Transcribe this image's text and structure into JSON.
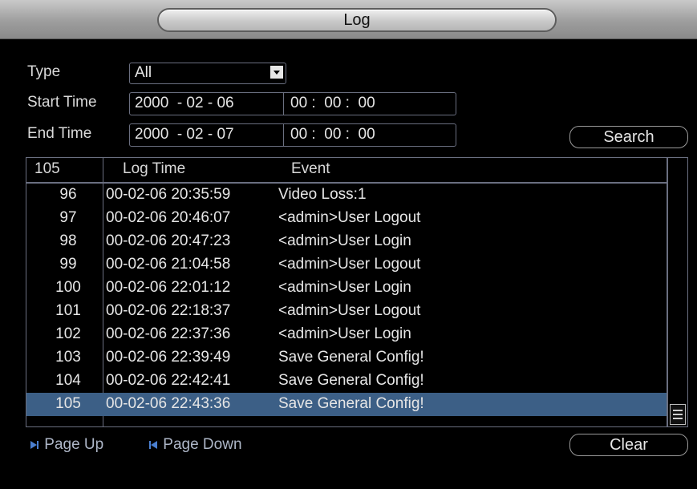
{
  "window": {
    "title": "Log"
  },
  "filters": {
    "type_label": "Type",
    "type_value": "All",
    "start_label": "Start Time",
    "start_date": "2000  - 02 - 06",
    "start_time": "00 :  00 :  00",
    "end_label": "End Time",
    "end_date": "2000  - 02 - 07",
    "end_time": "00 :  00 :  00",
    "search_label": "Search"
  },
  "table": {
    "header_count": "105",
    "col_time": "Log Time",
    "col_event": "Event",
    "rows": [
      {
        "no": "96",
        "time": "00-02-06 20:35:59",
        "event": "Video Loss:1"
      },
      {
        "no": "97",
        "time": "00-02-06 20:46:07",
        "event": "<admin>User Logout"
      },
      {
        "no": "98",
        "time": "00-02-06 20:47:23",
        "event": "<admin>User Login"
      },
      {
        "no": "99",
        "time": "00-02-06 21:04:58",
        "event": "<admin>User Logout"
      },
      {
        "no": "100",
        "time": "00-02-06 22:01:12",
        "event": "<admin>User Login"
      },
      {
        "no": "101",
        "time": "00-02-06 22:18:37",
        "event": "<admin>User Logout"
      },
      {
        "no": "102",
        "time": "00-02-06 22:37:36",
        "event": "<admin>User Login"
      },
      {
        "no": "103",
        "time": "00-02-06 22:39:49",
        "event": "Save General Config!"
      },
      {
        "no": "104",
        "time": "00-02-06 22:42:41",
        "event": "Save General Config!"
      },
      {
        "no": "105",
        "time": "00-02-06 22:43:36",
        "event": "Save General Config!"
      }
    ],
    "selected_row": 9
  },
  "footer": {
    "page_up": "Page Up",
    "page_down": "Page Down",
    "clear_label": "Clear"
  },
  "colors": {
    "selection": "#3c5f86",
    "border": "#6a6f80",
    "pager_icon": "#4a7fd0"
  }
}
